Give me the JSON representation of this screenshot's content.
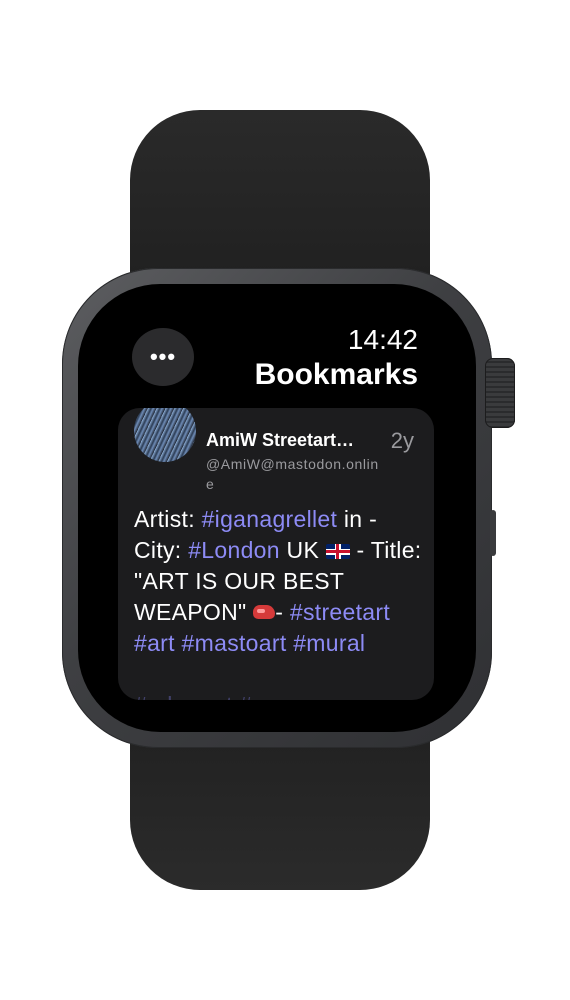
{
  "status": {
    "time": "14:42",
    "menu_label": "•••"
  },
  "header": {
    "title": "Bookmarks"
  },
  "post": {
    "author_name": "AmiW Streetart…",
    "handle": "@AmiW@mastodon.online",
    "age": "2y",
    "body": {
      "artist_prefix": "Artist: ",
      "artist_tag": "#iganagrellet",
      "artist_suffix": " in",
      "city_prefix": "- City: ",
      "city_tag": "#London",
      "city_suffix": " UK ",
      "flag_icon": "uk-flag-icon",
      "title_text": " - Title: \"ART IS OUR BEST WEAPON\" ",
      "glove_icon": "boxing-glove-icon",
      "title_suffix": "-",
      "tags": [
        "#streetart",
        "#art",
        "#mastoart",
        "#mural"
      ],
      "truncated_tag": "#urbanart #"
    }
  },
  "colors": {
    "accent": "#8d8bf5",
    "card_bg": "#1c1c1e",
    "screen_bg": "#000000",
    "secondary_text": "#9a9a9e"
  }
}
